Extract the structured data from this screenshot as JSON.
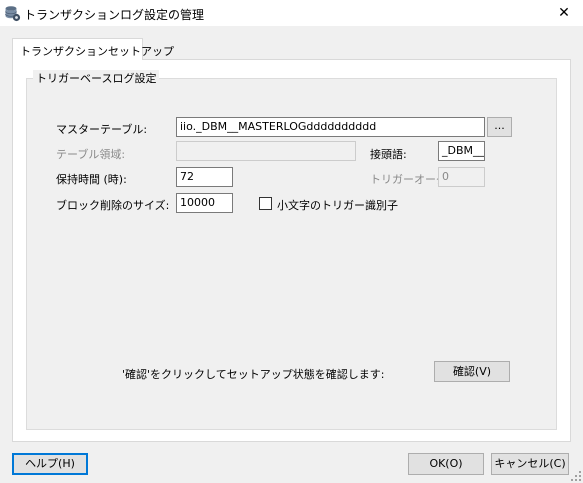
{
  "window": {
    "title": "トランザクションログ設定の管理",
    "close_glyph": "✕",
    "icon": "database-gear-icon"
  },
  "tabs": [
    {
      "label": "トランザクションセットアップ"
    }
  ],
  "group": {
    "title": "トリガーベースログ設定"
  },
  "fields": {
    "master_table": {
      "label": "マスターテーブル:",
      "value": "iio._DBM__MASTERLOGdddddddddd",
      "browse_label": "..."
    },
    "table_area": {
      "label": "テーブル領域:",
      "value": ""
    },
    "prefix": {
      "label": "接頭語:",
      "value": "_DBM__"
    },
    "retention": {
      "label": "保持時間 (時):",
      "value": "72"
    },
    "trigger_order": {
      "label": "トリガーオーダー",
      "value": "0"
    },
    "block_delete": {
      "label": "ブロック削除のサイズ:",
      "value": "10000"
    },
    "lowercase": {
      "label": "小文字のトリガー識別子",
      "checked": false
    }
  },
  "confirm": {
    "hint": "'確認'をクリックしてセットアップ状態を確認します:",
    "button": "確認(V)"
  },
  "footer": {
    "help": "ヘルプ(H)",
    "ok": "OK(O)",
    "cancel": "キャンセル(C)"
  },
  "colors": {
    "focus": "#0078d7",
    "dialog_bg": "#f0f0f0"
  }
}
